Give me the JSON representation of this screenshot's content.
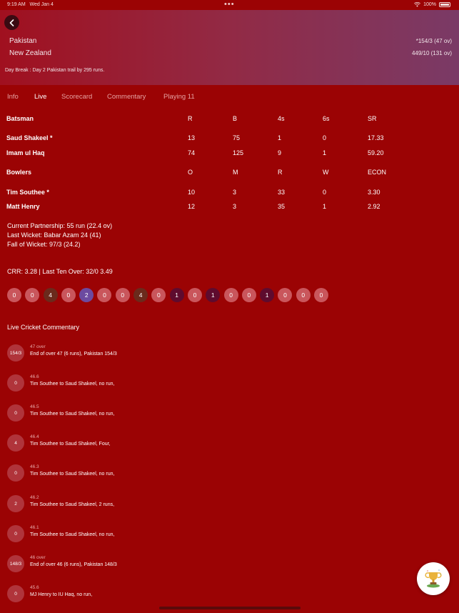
{
  "status_bar": {
    "time": "9:19 AM",
    "date": "Wed Jan 4",
    "battery": "100%",
    "dots": "•••"
  },
  "match": {
    "teams": [
      {
        "name": "Pakistan",
        "score": "*154/3 (47 ov)"
      },
      {
        "name": "New Zealand",
        "score": "449/10 (131 ov)"
      }
    ],
    "status": "Day Break : Day 2 Pakistan trail by 295 runs."
  },
  "tabs": [
    {
      "label": "Info",
      "active": false
    },
    {
      "label": "Live",
      "active": true
    },
    {
      "label": "Scorecard",
      "active": false
    },
    {
      "label": "Commentary",
      "active": false
    },
    {
      "label": "Playing 11",
      "active": false
    }
  ],
  "batting": {
    "headers": [
      "Batsman",
      "R",
      "B",
      "4s",
      "6s",
      "SR"
    ],
    "rows": [
      [
        "Saud Shakeel *",
        "13",
        "75",
        "1",
        "0",
        "17.33"
      ],
      [
        "Imam ul Haq",
        "74",
        "125",
        "9",
        "1",
        "59.20"
      ]
    ]
  },
  "bowling": {
    "headers": [
      "Bowlers",
      "O",
      "M",
      "R",
      "W",
      "ECON"
    ],
    "rows": [
      [
        "Tim Southee *",
        "10",
        "3",
        "33",
        "0",
        "3.30"
      ],
      [
        "Matt Henry",
        "12",
        "3",
        "35",
        "1",
        "2.92"
      ]
    ]
  },
  "partnership": {
    "current": "Current Partnership: 55 run (22.4 ov)",
    "last_wicket": "Last Wicket: Babar Azam 24 (41)",
    "fall_of_wicket": "Fall of  Wicket: 97/3 (24.2)"
  },
  "run_rate": "CRR: 3.28 | Last Ten Over: 32/0 3.49",
  "recent_balls": [
    {
      "v": "0",
      "kind": "dot"
    },
    {
      "v": "0",
      "kind": "dot"
    },
    {
      "v": "4",
      "kind": "four"
    },
    {
      "v": "0",
      "kind": "dot"
    },
    {
      "v": "2",
      "kind": "two"
    },
    {
      "v": "0",
      "kind": "dot"
    },
    {
      "v": "0",
      "kind": "dot"
    },
    {
      "v": "4",
      "kind": "four"
    },
    {
      "v": "0",
      "kind": "dot"
    },
    {
      "v": "1",
      "kind": "one"
    },
    {
      "v": "0",
      "kind": "dot"
    },
    {
      "v": "1",
      "kind": "one"
    },
    {
      "v": "0",
      "kind": "dot"
    },
    {
      "v": "0",
      "kind": "dot"
    },
    {
      "v": "1",
      "kind": "one"
    },
    {
      "v": "0",
      "kind": "dot"
    },
    {
      "v": "0",
      "kind": "dot"
    },
    {
      "v": "0",
      "kind": "dot"
    }
  ],
  "commentary_title": "Live Cricket Commentary",
  "commentary": [
    {
      "badge": "154/3",
      "over": "47 over",
      "text": "End of over 47 (6 runs), Pakistan 154/3"
    },
    {
      "badge": "0",
      "over": "46.6",
      "text": "Tim Southee to Saud Shakeel, no run,"
    },
    {
      "badge": "0",
      "over": "46.5",
      "text": "Tim Southee to Saud Shakeel, no run,"
    },
    {
      "badge": "4",
      "over": "46.4",
      "text": "Tim Southee to Saud Shakeel, Four,"
    },
    {
      "badge": "0",
      "over": "46.3",
      "text": "Tim Southee to Saud Shakeel, no run,"
    },
    {
      "badge": "2",
      "over": "46.2",
      "text": "Tim Southee to Saud Shakeel, 2 runs,"
    },
    {
      "badge": "0",
      "over": "46.1",
      "text": "Tim Southee to Saud Shakeel, no run,"
    },
    {
      "badge": "148/3",
      "over": "46 over",
      "text": "End of over 46 (6 runs), Pakistan 148/3"
    },
    {
      "badge": "0",
      "over": "45.6",
      "text": "MJ Henry to IU Haq, no run,"
    }
  ],
  "icons": {
    "back": "back-arrow-icon",
    "fab": "trophy-icon",
    "wifi": "wifi-icon",
    "battery": "battery-icon"
  },
  "colors": {
    "background": "#9b0304",
    "header_start": "#a0101f",
    "header_end": "#7a3a66",
    "tab_inactive": "#e6a2a2"
  }
}
